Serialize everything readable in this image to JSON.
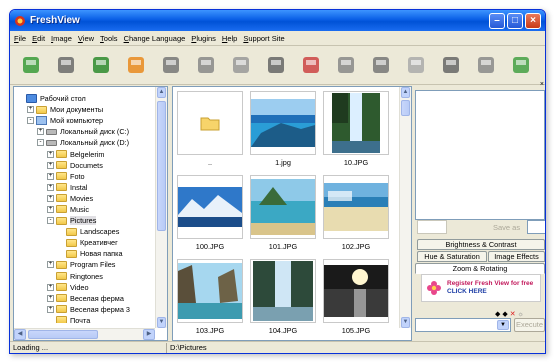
{
  "window": {
    "title": "FreshView"
  },
  "menu": [
    "File",
    "Edit",
    "Image",
    "View",
    "Tools",
    "Change Language",
    "Plugins",
    "Help",
    "Support Site"
  ],
  "toolbar_icons": [
    "folder-stack-icon",
    "hard-disk-icon",
    "refresh-icon",
    "add-folder-icon",
    "scissors-icon",
    "clipboard-icon",
    "paste-icon",
    "document-icon",
    "contact-sheet-icon",
    "slideshow-icon",
    "copy-pages-icon",
    "open-document-icon",
    "checkmark-icon",
    "image-icon",
    "plugin-icon"
  ],
  "tree": [
    {
      "label": "Рабочий стол",
      "indent": 0,
      "exp": "",
      "icon": "desktop-icon"
    },
    {
      "label": "Мои документы",
      "indent": 1,
      "exp": "+",
      "icon": "folder-icon"
    },
    {
      "label": "Мой компьютер",
      "indent": 1,
      "exp": "-",
      "icon": "computer-icon"
    },
    {
      "label": "Локальный диск (C:)",
      "indent": 2,
      "exp": "+",
      "icon": "drive-icon"
    },
    {
      "label": "Локальный диск (D:)",
      "indent": 2,
      "exp": "-",
      "icon": "drive-icon"
    },
    {
      "label": "Belgelerim",
      "indent": 3,
      "exp": "+",
      "icon": "folder-icon"
    },
    {
      "label": "Documets",
      "indent": 3,
      "exp": "+",
      "icon": "folder-icon"
    },
    {
      "label": "Foto",
      "indent": 3,
      "exp": "+",
      "icon": "folder-icon"
    },
    {
      "label": "Instal",
      "indent": 3,
      "exp": "+",
      "icon": "folder-icon"
    },
    {
      "label": "Movies",
      "indent": 3,
      "exp": "+",
      "icon": "folder-icon"
    },
    {
      "label": "Music",
      "indent": 3,
      "exp": "+",
      "icon": "folder-icon"
    },
    {
      "label": "Pictures",
      "indent": 3,
      "exp": "-",
      "icon": "folder-icon",
      "selected": true
    },
    {
      "label": "Landscapes",
      "indent": 4,
      "exp": "",
      "icon": "folder-icon"
    },
    {
      "label": "Креативчег",
      "indent": 4,
      "exp": "",
      "icon": "folder-icon"
    },
    {
      "label": "Новая папка",
      "indent": 4,
      "exp": "",
      "icon": "folder-icon"
    },
    {
      "label": "Program Files",
      "indent": 3,
      "exp": "+",
      "icon": "folder-icon"
    },
    {
      "label": "Ringtones",
      "indent": 3,
      "exp": "",
      "icon": "folder-icon"
    },
    {
      "label": "Video",
      "indent": 3,
      "exp": "+",
      "icon": "folder-icon"
    },
    {
      "label": "Веселая ферма",
      "indent": 3,
      "exp": "+",
      "icon": "folder-icon"
    },
    {
      "label": "Веселая ферма 3",
      "indent": 3,
      "exp": "+",
      "icon": "folder-icon"
    },
    {
      "label": "Почта",
      "indent": 3,
      "exp": "",
      "icon": "folder-icon"
    }
  ],
  "thumbnails": [
    {
      "caption": "..",
      "kind": "folder"
    },
    {
      "caption": "1.jpg",
      "kind": "sea"
    },
    {
      "caption": "10.JPG",
      "kind": "waterfall"
    },
    {
      "caption": "100.JPG",
      "kind": "mountains"
    },
    {
      "caption": "101.JPG",
      "kind": "island"
    },
    {
      "caption": "102.JPG",
      "kind": "beach"
    },
    {
      "caption": "103.JPG",
      "kind": "rocks"
    },
    {
      "caption": "104.JPG",
      "kind": "falls"
    },
    {
      "caption": "105.JPG",
      "kind": "sunset"
    }
  ],
  "right": {
    "save_as": "Save as",
    "tabs": [
      "Brightness & Contrast",
      "Hue & Saturation",
      "Image Effects",
      "Zoom & Rotating"
    ],
    "banner_line1": "Register Fresh View for free",
    "banner_line2": "CLICK HERE",
    "execute": "Execute"
  },
  "status": {
    "left": "Loading ...",
    "path": "D:\\Pictures"
  }
}
